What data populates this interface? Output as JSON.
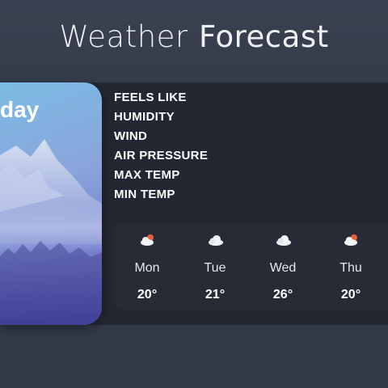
{
  "header": {
    "title_light": "Weather",
    "title_bold": "Forecast"
  },
  "hero": {
    "day_label": "day"
  },
  "details": [
    {
      "label": "FEELS LIKE"
    },
    {
      "label": "HUMIDITY"
    },
    {
      "label": "WIND"
    },
    {
      "label": "AIR PRESSURE"
    },
    {
      "label": "MAX TEMP"
    },
    {
      "label": "MIN TEMP"
    }
  ],
  "forecast": [
    {
      "day": "Mon",
      "temp": "20°",
      "icon": "sun-behind-cloud-icon"
    },
    {
      "day": "Tue",
      "temp": "21°",
      "icon": "cloud-icon"
    },
    {
      "day": "Wed",
      "temp": "26°",
      "icon": "cloud-icon"
    },
    {
      "day": "Thu",
      "temp": "20°",
      "icon": "sun-behind-cloud-icon"
    }
  ],
  "colors": {
    "background": "#333a48",
    "panel": "#232731",
    "strip": "#262b35",
    "sun": "#e8603a"
  }
}
